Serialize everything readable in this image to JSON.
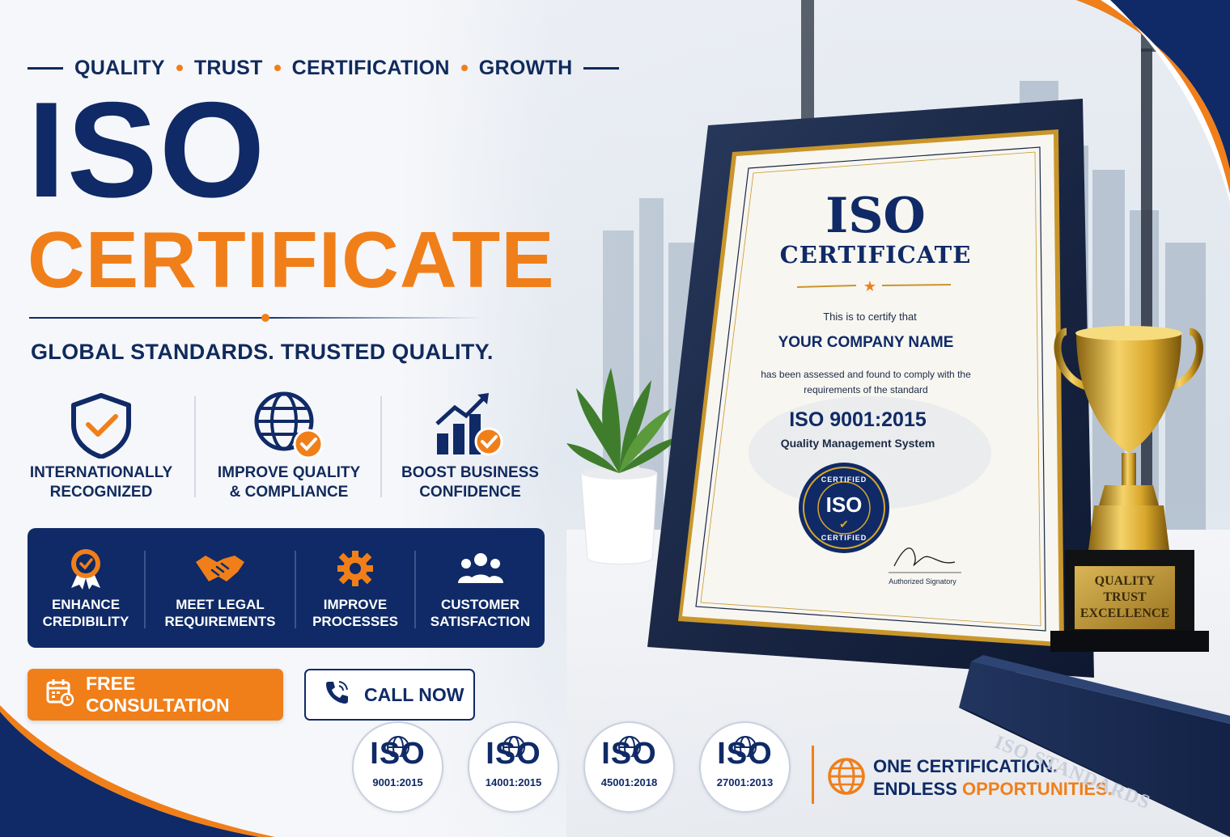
{
  "header": {
    "tagline": [
      "QUALITY",
      "TRUST",
      "CERTIFICATION",
      "GROWTH"
    ],
    "title_line1": "ISO",
    "title_line2": "CERTIFICATE",
    "subtitle": "GLOBAL STANDARDS. TRUSTED QUALITY."
  },
  "benefits": [
    {
      "label_l1": "INTERNATIONALLY",
      "label_l2": "RECOGNIZED",
      "icon": "shield-check-icon"
    },
    {
      "label_l1": "IMPROVE QUALITY",
      "label_l2": "& COMPLIANCE",
      "icon": "globe-check-icon"
    },
    {
      "label_l1": "BOOST BUSINESS",
      "label_l2": "CONFIDENCE",
      "icon": "growth-chart-icon"
    }
  ],
  "features": [
    {
      "label_l1": "ENHANCE",
      "label_l2": "CREDIBILITY",
      "icon": "award-ribbon-icon"
    },
    {
      "label_l1": "MEET LEGAL",
      "label_l2": "REQUIREMENTS",
      "icon": "handshake-icon"
    },
    {
      "label_l1": "IMPROVE",
      "label_l2": "PROCESSES",
      "icon": "gear-icon"
    },
    {
      "label_l1": "CUSTOMER",
      "label_l2": "SATISFACTION",
      "icon": "people-icon"
    }
  ],
  "cta": {
    "consult_label": "FREE CONSULTATION",
    "call_label": "CALL NOW"
  },
  "standards": [
    {
      "name": "ISO",
      "code": "9001:2015"
    },
    {
      "name": "ISO",
      "code": "14001:2015"
    },
    {
      "name": "ISO",
      "code": "45001:2018"
    },
    {
      "name": "ISO",
      "code": "27001:2013"
    }
  ],
  "slogan": {
    "line1": "ONE CERTIFICATION.",
    "line2_a": "ENDLESS ",
    "line2_b": "OPPORTUNITIES."
  },
  "certificate": {
    "title": "ISO",
    "subtitle": "CERTIFICATE",
    "intro": "This is to certify that",
    "company": "YOUR COMPANY NAME",
    "body_l1": "has been assessed and found to comply with the",
    "body_l2": "requirements of the standard",
    "standard": "ISO 9001:2015",
    "system": "Quality Management System",
    "seal_top": "CERTIFIED",
    "seal_center": "ISO",
    "seal_bottom": "CERTIFIED",
    "signatory": "Authorized Signatory"
  },
  "trophy": {
    "line1": "QUALITY",
    "line2": "TRUST",
    "line3": "EXCELLENCE"
  },
  "book": {
    "title": "ISO STANDARDS"
  },
  "colors": {
    "navy": "#0f2a66",
    "orange": "#f07f1a",
    "white": "#ffffff"
  }
}
